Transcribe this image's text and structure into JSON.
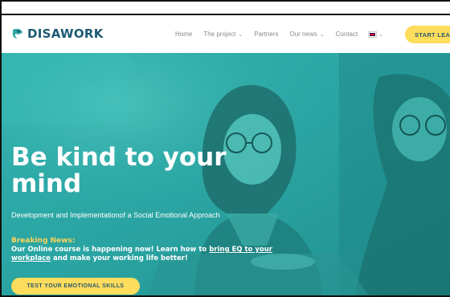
{
  "brand": {
    "name": "DISAWORK"
  },
  "nav": {
    "items": [
      {
        "label": "Home",
        "dropdown": false
      },
      {
        "label": "The project",
        "dropdown": true
      },
      {
        "label": "Partners",
        "dropdown": false
      },
      {
        "label": "Our news",
        "dropdown": true
      },
      {
        "label": "Contact",
        "dropdown": false
      }
    ],
    "language_icon": "uk-flag-icon",
    "cta_label": "START LEAR"
  },
  "hero": {
    "title": "Be kind to your mind",
    "subtitle": "Development and Implementationof a Social Emotional Approach",
    "breaking_label": "Breaking News:",
    "breaking_text_1": "Our Online course is happening now! Learn how to ",
    "breaking_link": "bring EQ to your workplace",
    "breaking_text_2": " and make your working life better!",
    "cta_label": "TEST YOUR EMOTIONAL SKILLS"
  },
  "colors": {
    "accent_yellow": "#fedc5c",
    "hero_teal": "#2aa6a4",
    "brand_blue": "#1c5a73",
    "breaking_yellow": "#fdd25a"
  }
}
